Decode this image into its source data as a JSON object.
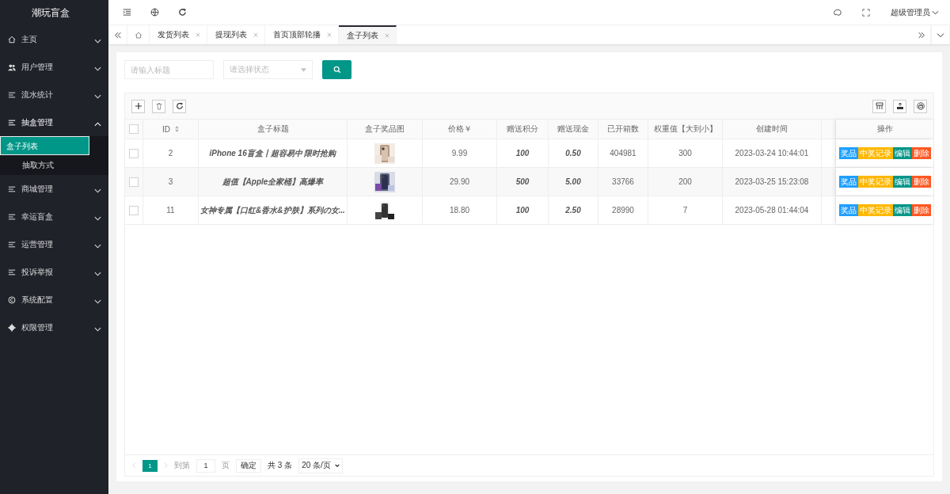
{
  "app_title": "潮玩盲盒",
  "sidebar": {
    "items": [
      {
        "label": "主页",
        "expanded": false
      },
      {
        "label": "用户管理",
        "expanded": false
      },
      {
        "label": "流水统计",
        "expanded": false
      },
      {
        "label": "抽盒管理",
        "expanded": true,
        "children": [
          {
            "label": "盒子列表",
            "selected": true
          },
          {
            "label": "抽取方式",
            "selected": false
          }
        ]
      },
      {
        "label": "商城管理",
        "expanded": false
      },
      {
        "label": "幸运盲盒",
        "expanded": false
      },
      {
        "label": "运营管理",
        "expanded": false
      },
      {
        "label": "投诉举报",
        "expanded": false
      },
      {
        "label": "系统配置",
        "expanded": false
      },
      {
        "label": "权限管理",
        "expanded": false
      }
    ]
  },
  "header": {
    "user": "超级管理员"
  },
  "tabs": [
    {
      "label": "发货列表",
      "selected": false
    },
    {
      "label": "提现列表",
      "selected": false
    },
    {
      "label": "首页顶部轮播",
      "selected": false
    },
    {
      "label": "盒子列表",
      "selected": true
    }
  ],
  "filters": {
    "title_placeholder": "请输入标题",
    "status_placeholder": "请选择状态"
  },
  "table": {
    "select_all_checked": false,
    "columns": [
      "ID",
      "盒子标题",
      "盒子奖品图",
      "价格￥",
      "赠送积分",
      "赠送现金",
      "已开箱数",
      "权重值【大到小】",
      "创建时间",
      "操作"
    ],
    "rows": [
      {
        "checked": false,
        "id": "2",
        "title": "iPhone 16盲盒丨超容易中 限时抢购",
        "price": "9.99",
        "points": "100",
        "cash": "0.50",
        "opened": "404981",
        "weight": "300",
        "created": "2023-03-24 10:44:01",
        "actions": [
          "奖品",
          "中奖记录",
          "编辑",
          "删除"
        ]
      },
      {
        "checked": false,
        "id": "3",
        "title": "超值【Apple全家桶】高爆率",
        "price": "29.90",
        "points": "500",
        "cash": "5.00",
        "opened": "33766",
        "weight": "200",
        "created": "2023-03-25 15:23:08",
        "actions": [
          "奖品",
          "中奖记录",
          "编辑",
          "删除"
        ]
      },
      {
        "checked": false,
        "id": "11",
        "title": "女神专属【口红&香水&护肤】系列の女...",
        "price": "18.80",
        "points": "100",
        "cash": "2.50",
        "opened": "28990",
        "weight": "7",
        "created": "2023-05-28 01:44:04",
        "actions": [
          "奖品",
          "中奖记录",
          "编辑",
          "删除"
        ]
      }
    ]
  },
  "pagination": {
    "pages": [
      {
        "label": "1",
        "selected": true
      }
    ],
    "goto_label": "到第",
    "goto_value": "1",
    "page_unit": "页",
    "confirm": "确定",
    "total": "共 3 条",
    "page_size": "20 条/页"
  }
}
